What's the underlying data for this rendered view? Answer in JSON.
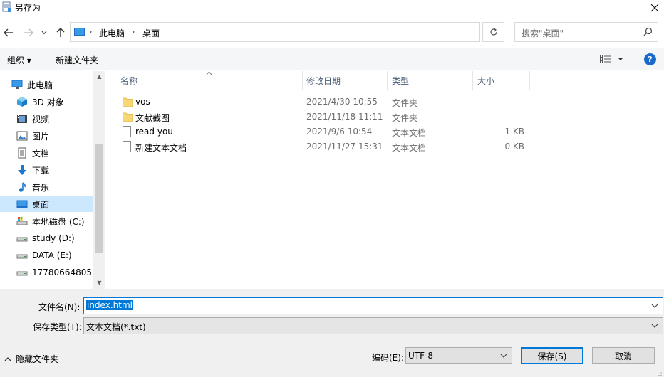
{
  "window": {
    "title": "另存为"
  },
  "address": {
    "path": [
      "此电脑",
      "桌面"
    ],
    "search_placeholder": "搜索\"桌面\""
  },
  "toolbar": {
    "organize_label": "组织 ▾",
    "new_folder_label": "新建文件夹",
    "help_label": "?"
  },
  "nav": {
    "items": [
      {
        "label": "此电脑",
        "icon": "pc-icon"
      },
      {
        "label": "3D 对象",
        "icon": "3d-objects-icon"
      },
      {
        "label": "视频",
        "icon": "video-icon"
      },
      {
        "label": "图片",
        "icon": "picture-icon"
      },
      {
        "label": "文档",
        "icon": "document-icon"
      },
      {
        "label": "下载",
        "icon": "download-icon"
      },
      {
        "label": "音乐",
        "icon": "music-icon"
      },
      {
        "label": "桌面",
        "icon": "desktop-icon",
        "selected": true
      },
      {
        "label": "本地磁盘 (C:)",
        "icon": "drive-icon"
      },
      {
        "label": "study (D:)",
        "icon": "drive-icon"
      },
      {
        "label": "DATA (E:)",
        "icon": "drive-icon"
      },
      {
        "label": "17780664805 (",
        "icon": "drive-icon"
      }
    ]
  },
  "columns": {
    "name": "名称",
    "modified": "修改日期",
    "type": "类型",
    "size": "大小"
  },
  "files": [
    {
      "name": "vos",
      "modified": "2021/4/30 10:55",
      "type": "文件夹",
      "size": "",
      "icon": "folder-icon"
    },
    {
      "name": "文献截图",
      "modified": "2021/11/18 11:11",
      "type": "文件夹",
      "size": "",
      "icon": "folder-icon"
    },
    {
      "name": "read you",
      "modified": "2021/9/6 10:54",
      "type": "文本文档",
      "size": "1 KB",
      "icon": "text-file-icon"
    },
    {
      "name": "新建文本文档",
      "modified": "2021/11/27 15:31",
      "type": "文本文档",
      "size": "0 KB",
      "icon": "text-file-icon"
    }
  ],
  "save": {
    "filename_label": "文件名(N):",
    "filename_value": "index.html",
    "filetype_label": "保存类型(T):",
    "filetype_value": "文本文档(*.txt)",
    "hide_folders_label": "隐藏文件夹",
    "encoding_label": "编码(E):",
    "encoding_value": "UTF-8",
    "save_button": "保存(S)",
    "cancel_button": "取消"
  },
  "colors": {
    "accent": "#0078d7",
    "selection": "#cce8ff",
    "folder": "#f8d775"
  }
}
